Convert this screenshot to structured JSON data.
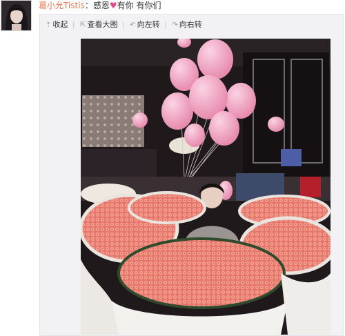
{
  "post": {
    "author": "葛小允Tistis",
    "colon": "：",
    "text_before": "感恩",
    "heart": "♥",
    "text_after": "有你 有你们"
  },
  "toolbar": {
    "collapse": {
      "icon": "arrow-up-icon",
      "glyph": "⇡",
      "label": "收起"
    },
    "view_large": {
      "icon": "external-link-icon",
      "glyph": "⇱",
      "label": "查看大图"
    },
    "rotate_left": {
      "icon": "rotate-left-icon",
      "glyph": "↶",
      "label": "向左转"
    },
    "rotate_right": {
      "icon": "rotate-right-icon",
      "glyph": "↷",
      "label": "向右转"
    },
    "separator": "|"
  },
  "colors": {
    "author_link": "#eb7350",
    "heart": "#e0488f",
    "panel_bg": "#f2f2f5",
    "balloon": "#f2a6c4",
    "roses": "#f08f84"
  }
}
